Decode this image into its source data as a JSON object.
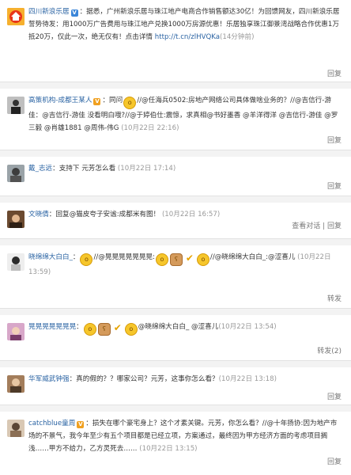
{
  "posts": [
    {
      "user": "四川新浪乐居",
      "verified": true,
      "text": "：据悉，广州新浪乐居与珠江地产电商合作销售额达30亿！为回馈网友，四川新浪乐居誓势待发：用1000万广告费用与珠江地产兑换1000万房源优惠！乐居独享珠江御景湾战略合作优惠1万抵20万，仅此一次，绝无仅有！点击详情",
      "link": "http://t.cn/zlHVQKa",
      "time": "(14分钟前)",
      "reply": "回复"
    },
    {
      "user": "高策机构-成都王某人",
      "text_a": "：同问",
      "text_b": "//@任海兵0502:房地产网络公司具体做啥业务的？//@吉信行-游佳：@吉信行-游佳 没看明白哦?//@于婷伯仕:震惊，求真相@书好墨香 @羊洋得洋 @吉信行-游佳 @罗三毅 @肖雄1881 @周伟-伟G",
      "time": "(10月22日 22:16)",
      "reply": "回复"
    },
    {
      "user": "戴_志远",
      "text": "：支持下 元芳怎么看",
      "time": "(10月22日 17:14)",
      "reply": "回复"
    },
    {
      "user": "文晓倩",
      "text": "：回复@猫皮夸子安谧:成都米有图！",
      "time": "(10月22日 16:57)",
      "actions": "查看对话 | 回复"
    },
    {
      "user": "晓绵绵大白白_",
      "text_a": "：",
      "text_b": "//@晃晃晃晃晃晃晃:",
      "text_c": "//@晓绵绵大白白_:@涩喜儿",
      "time": "(10月22日 13:59)",
      "reply": "转发"
    },
    {
      "user": "晃晃晃晃晃晃晃",
      "text_a": "：",
      "text_b": "@晓绵绵大白白_ @涩喜儿",
      "time": "(10月22日 13:54)",
      "reply": "转发(2)"
    },
    {
      "user": "华军威武钟强",
      "text": "：真的假的？？哪家公司？元芳，这事你怎么看？",
      "time": "(10月22日 13:18)",
      "reply": "回复"
    },
    {
      "user": "catchblue童周",
      "verified": true,
      "text": "：损失在哪个豪宅身上？这个才素关键。元芳，你怎么看？//@十年扬协:因为地产市场的不景气，我今年至少有五个项目都是已经立项，方案通过，最终因为甲方经济方面的考虑项目搁浅……甲方不给力，乙方灵死去……",
      "time": "(10月22日 13:15)",
      "reply": "回复"
    }
  ]
}
